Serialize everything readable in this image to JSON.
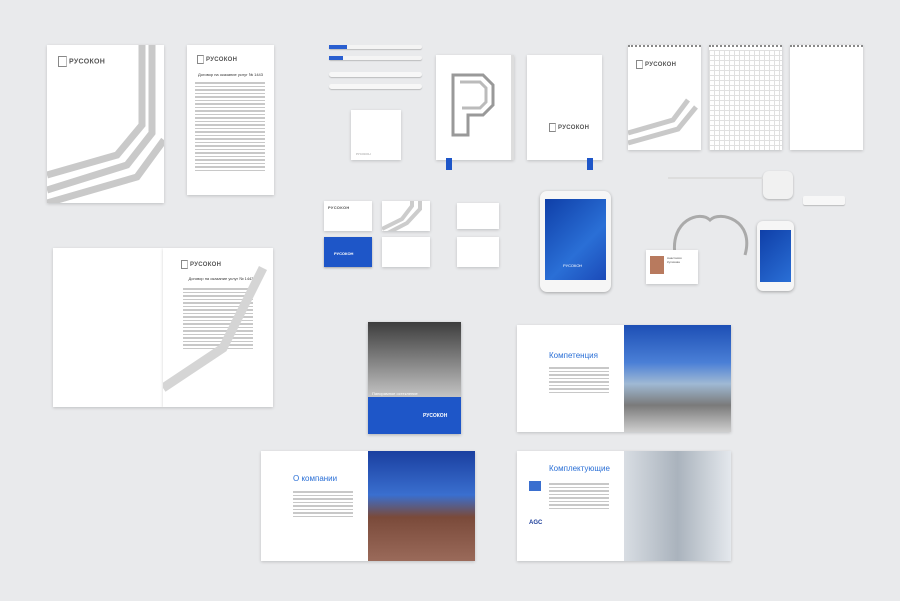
{
  "brand": {
    "name": "РУСОКОН",
    "tagline": "ИНДУСТРИЯ ФАСАДОВ"
  },
  "documents": {
    "contract_title": "Договор на оказание услуг № 1443"
  },
  "brochures": {
    "cover_caption": "Панорамное остекление",
    "competence_title": "Компетенция",
    "about_title": "О компании",
    "components_title": "Комплектующие",
    "agc_logo": "AGC"
  },
  "badge": {
    "name": "Анастасия Куликова"
  },
  "colors": {
    "brand_blue": "#1e56c8",
    "background": "#e9eaec",
    "stripe_gray": "#c9c9c9"
  }
}
